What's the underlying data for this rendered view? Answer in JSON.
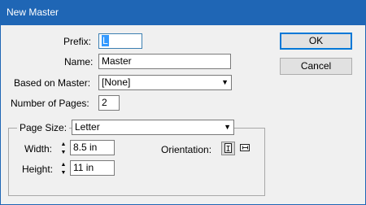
{
  "window": {
    "title": "New Master"
  },
  "form": {
    "prefix_label": "Prefix:",
    "prefix_value": "L",
    "name_label": "Name:",
    "name_value": "Master",
    "based_on_label": "Based on Master:",
    "based_on_value": "[None]",
    "pages_label": "Number of Pages:",
    "pages_value": "2"
  },
  "page_size": {
    "label": "Page Size:",
    "value": "Letter",
    "width_label": "Width:",
    "width_value": "8.5 in",
    "height_label": "Height:",
    "height_value": "11 in",
    "orientation_label": "Orientation:",
    "orientation_selected": "portrait"
  },
  "buttons": {
    "ok": "OK",
    "cancel": "Cancel"
  },
  "icons": {
    "dropdown": "chevron-down-icon",
    "spin_up": "spin-up-icon",
    "spin_down": "spin-down-icon",
    "portrait": "portrait-icon",
    "landscape": "landscape-icon"
  },
  "colors": {
    "titlebar": "#1f66b5",
    "selection": "#3399ff",
    "default_button_border": "#0078d7"
  }
}
